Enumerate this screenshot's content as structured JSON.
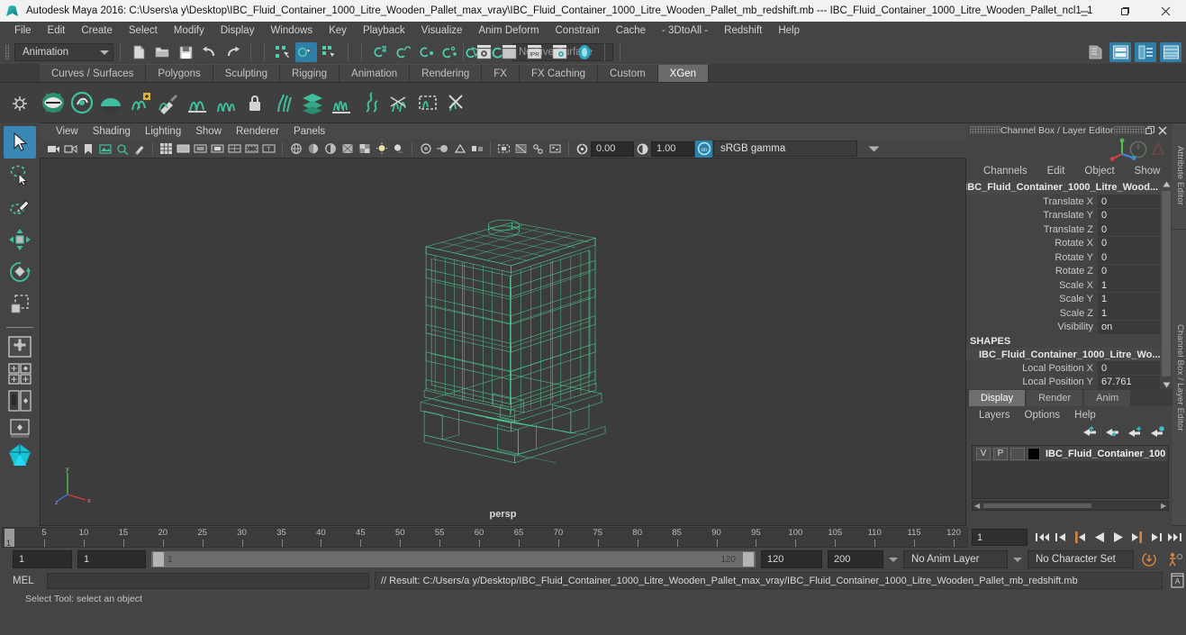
{
  "window": {
    "title": "Autodesk Maya 2016: C:\\Users\\a y\\Desktop\\IBC_Fluid_Container_1000_Litre_Wooden_Pallet_max_vray\\IBC_Fluid_Container_1000_Litre_Wooden_Pallet_mb_redshift.mb  ---  IBC_Fluid_Container_1000_Litre_Wooden_Pallet_ncl1_1",
    "minimize": "–",
    "maximize": "❐",
    "close": "✕"
  },
  "menubar": {
    "items": [
      {
        "label": "File"
      },
      {
        "label": "Edit"
      },
      {
        "label": "Create"
      },
      {
        "label": "Select"
      },
      {
        "label": "Modify"
      },
      {
        "label": "Display"
      },
      {
        "label": "Windows"
      },
      {
        "label": "Key"
      },
      {
        "label": "Playback"
      },
      {
        "label": "Visualize"
      },
      {
        "label": "Anim Deform"
      },
      {
        "label": "Constrain"
      },
      {
        "label": "Cache"
      },
      {
        "label": "- 3DtoAll -"
      },
      {
        "label": "Redshift"
      },
      {
        "label": "Help"
      }
    ]
  },
  "statusline": {
    "menuset": "Animation",
    "live_surface": "No Live Surface",
    "icons": [
      "new-scene-icon",
      "open-scene-icon",
      "save-scene-icon",
      "undo-icon",
      "redo-icon",
      "select-by-hierarchy-icon",
      "select-by-object-icon",
      "select-by-component-icon",
      "snap-to-grid-icon",
      "snap-to-curve-icon",
      "snap-to-point-icon",
      "snap-to-projected-center-icon",
      "snap-to-view-plane-icon",
      "make-live-icon",
      "render-current-frame-icon",
      "render-sequence-icon",
      "ipr-render-icon",
      "render-settings-icon",
      "hypershade-icon",
      "show-hide-sidebar-icon",
      "attribute-editor-toggle-icon",
      "tool-settings-toggle-icon",
      "channel-box-toggle-icon"
    ]
  },
  "shelf": {
    "tabs": [
      {
        "label": "Curves / Surfaces",
        "active": false
      },
      {
        "label": "Polygons",
        "active": false
      },
      {
        "label": "Sculpting",
        "active": false
      },
      {
        "label": "Rigging",
        "active": false
      },
      {
        "label": "Animation",
        "active": false
      },
      {
        "label": "Rendering",
        "active": false
      },
      {
        "label": "FX",
        "active": false
      },
      {
        "label": "FX Caching",
        "active": false
      },
      {
        "label": "Custom",
        "active": false
      },
      {
        "label": "XGen",
        "active": true
      }
    ],
    "icons": [
      "xgen-create-description-icon",
      "xgen-preview-icon",
      "xgen-sphere-icon",
      "xgen-add-icon",
      "xgen-brush-icon",
      "xgen-grooming-icon",
      "xgen-density-icon",
      "xgen-lock-icon",
      "xgen-clump-icon",
      "xgen-layer-icon",
      "xgen-noise-icon",
      "xgen-coil-icon",
      "xgen-cut-icon",
      "xgen-region-icon",
      "xgen-remove-icon"
    ]
  },
  "toolbox": {
    "tools": [
      {
        "name": "select-tool",
        "selected": true
      },
      {
        "name": "lasso-select-tool",
        "selected": false
      },
      {
        "name": "paint-select-tool",
        "selected": false
      },
      {
        "name": "move-tool",
        "selected": false
      },
      {
        "name": "rotate-tool",
        "selected": false
      },
      {
        "name": "scale-tool",
        "selected": false
      }
    ],
    "layouts": [
      "single-perspective-layout",
      "four-view-layout",
      "outliner-persp-layout",
      "persp-graph-layout",
      "hypershade-persp-layout"
    ]
  },
  "viewport": {
    "menus": [
      {
        "label": "View"
      },
      {
        "label": "Shading"
      },
      {
        "label": "Lighting"
      },
      {
        "label": "Show"
      },
      {
        "label": "Renderer"
      },
      {
        "label": "Panels"
      }
    ],
    "exposure": "0.00",
    "gamma": "1.00",
    "color_profile": "sRGB gamma",
    "camera_label": "persp",
    "wireframe_color": "#4cd99a",
    "background_color": "#3c3c3c"
  },
  "channelbox": {
    "panel_title": "Channel Box / Layer Editor",
    "menus": [
      {
        "label": "Channels"
      },
      {
        "label": "Edit"
      },
      {
        "label": "Object"
      },
      {
        "label": "Show"
      }
    ],
    "object_name": "IBC_Fluid_Container_1000_Litre_Wood...",
    "transform_attrs": [
      {
        "label": "Translate X",
        "value": "0"
      },
      {
        "label": "Translate Y",
        "value": "0"
      },
      {
        "label": "Translate Z",
        "value": "0"
      },
      {
        "label": "Rotate X",
        "value": "0"
      },
      {
        "label": "Rotate Y",
        "value": "0"
      },
      {
        "label": "Rotate Z",
        "value": "0"
      },
      {
        "label": "Scale X",
        "value": "1"
      },
      {
        "label": "Scale Y",
        "value": "1"
      },
      {
        "label": "Scale Z",
        "value": "1"
      },
      {
        "label": "Visibility",
        "value": "on"
      }
    ],
    "shapes_header": "SHAPES",
    "shape_name": "IBC_Fluid_Container_1000_Litre_Wo...",
    "shape_attrs": [
      {
        "label": "Local Position X",
        "value": "0"
      },
      {
        "label": "Local Position Y",
        "value": "67.761"
      }
    ]
  },
  "layereditor": {
    "tabs": [
      {
        "label": "Display",
        "active": true
      },
      {
        "label": "Render",
        "active": false
      },
      {
        "label": "Anim",
        "active": false
      }
    ],
    "menus": [
      {
        "label": "Layers"
      },
      {
        "label": "Options"
      },
      {
        "label": "Help"
      }
    ],
    "buttons": [
      "move-layer-up-icon",
      "move-layer-down-icon",
      "new-layer-icon",
      "new-layer-from-selected-icon"
    ],
    "layer_row": {
      "visibility": "V",
      "playback": "P",
      "shading": "",
      "color": "#000000",
      "name": "IBC_Fluid_Container_100"
    }
  },
  "sidetabs": [
    {
      "label": "Attribute Editor"
    },
    {
      "label": "Channel Box / Layer Editor"
    }
  ],
  "timeline": {
    "start": 1,
    "end": 120,
    "current_frame": "1",
    "ticks": [
      5,
      10,
      15,
      20,
      25,
      30,
      35,
      40,
      45,
      50,
      55,
      60,
      65,
      70,
      75,
      80,
      85,
      90,
      95,
      100,
      105,
      110,
      115,
      120
    ],
    "current_marker_label": "1",
    "playback_buttons": [
      "go-to-start-icon",
      "step-back-keyframe-icon",
      "step-back-frame-icon",
      "play-backwards-icon",
      "play-forwards-icon",
      "step-forward-frame-icon",
      "step-forward-keyframe-icon",
      "go-to-end-icon"
    ]
  },
  "rangeslider": {
    "anim_start": "1",
    "range_start": "1",
    "bar_start_label": "1",
    "bar_end_label": "120",
    "range_end": "120",
    "anim_end": "200",
    "anim_layer": "No Anim Layer",
    "character_set": "No Character Set",
    "buttons": [
      "auto-keyframe-icon",
      "animation-preferences-icon"
    ]
  },
  "commandline": {
    "label": "MEL",
    "input_value": "",
    "result": "// Result: C:/Users/a y/Desktop/IBC_Fluid_Container_1000_Litre_Wooden_Pallet_max_vray/IBC_Fluid_Container_1000_Litre_Wooden_Pallet_mb_redshift.mb",
    "script_editor_icon": "script-editor-icon"
  },
  "statusbar": {
    "text": "Select Tool: select an object"
  }
}
